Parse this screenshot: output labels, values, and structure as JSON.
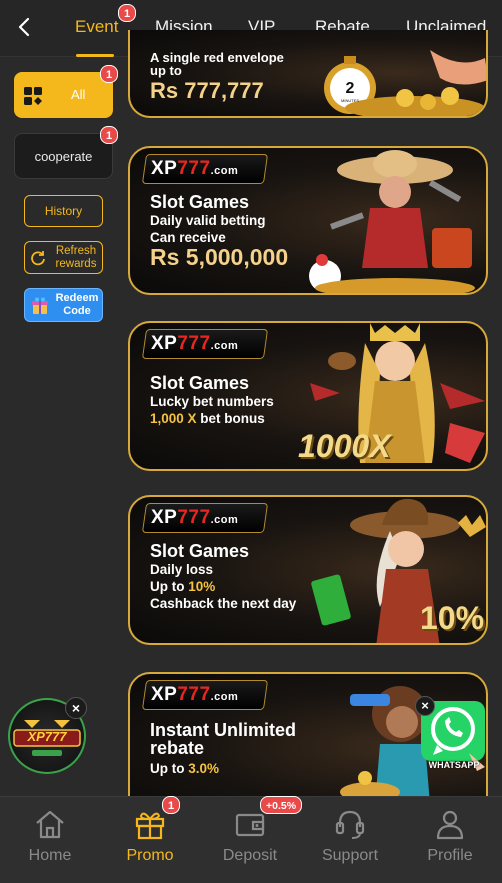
{
  "colors": {
    "accent": "#f5b81c",
    "badge": "#e84a4a",
    "background": "#2a2a2a",
    "redeem": "#2e8ff0",
    "whatsapp": "#25d366"
  },
  "header": {
    "tabs": [
      {
        "label": "Event",
        "active": true,
        "badge": "1"
      },
      {
        "label": "Mission"
      },
      {
        "label": "VIP"
      },
      {
        "label": "Rebate"
      },
      {
        "label": "Unclaimed"
      }
    ]
  },
  "sidebar": {
    "all": {
      "label": "All",
      "badge": "1"
    },
    "cooperate": {
      "label": "cooperate",
      "badge": "1"
    },
    "history": "History",
    "refresh": "Refresh rewards",
    "redeem": "Redeem Code"
  },
  "banners": [
    {
      "line1": "A single red envelope",
      "line2": "up to",
      "amount": "Rs 777,777",
      "timer": "2",
      "timer_unit": "MINUTES"
    },
    {
      "brand": "XP",
      "brand_num": "777",
      "brand_suffix": ".com",
      "title": "Slot Games",
      "line1": "Daily valid betting",
      "line2": "Can receive",
      "amount": "Rs 5,000,000"
    },
    {
      "brand": "XP",
      "brand_num": "777",
      "brand_suffix": ".com",
      "title": "Slot Games",
      "line1": "Lucky bet numbers",
      "line2_gold": "1,000 X",
      "line2_rest": " bet bonus",
      "art_text": "1000X"
    },
    {
      "brand": "XP",
      "brand_num": "777",
      "brand_suffix": ".com",
      "title": "Slot Games",
      "line1": "Daily loss",
      "line2_prefix": "Up to ",
      "line2_gold": "10%",
      "line3": "Cashback the next day",
      "art_text": "10%"
    },
    {
      "brand": "XP",
      "brand_num": "777",
      "brand_suffix": ".com",
      "title1": "Instant Unlimited",
      "title2": "rebate",
      "line1_prefix": "Up to ",
      "line1_gold": "3.0%"
    }
  ],
  "floating": {
    "logo_text": "XP777",
    "whatsapp_label": "WHATSAPP"
  },
  "bottom_nav": [
    {
      "label": "Home",
      "icon": "home-icon"
    },
    {
      "label": "Promo",
      "icon": "gift-icon",
      "active": true,
      "badge": "1"
    },
    {
      "label": "Deposit",
      "icon": "wallet-icon",
      "badge": "+0.5%"
    },
    {
      "label": "Support",
      "icon": "headset-icon"
    },
    {
      "label": "Profile",
      "icon": "user-icon"
    }
  ]
}
